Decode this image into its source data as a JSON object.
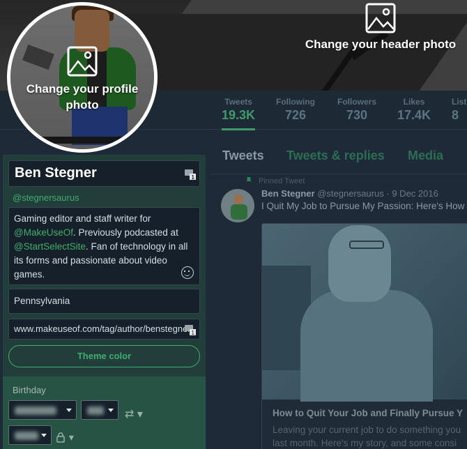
{
  "header": {
    "change_header_label": "Change your header photo"
  },
  "avatar": {
    "change_profile_label": "Change your profile photo"
  },
  "stats": [
    {
      "label": "Tweets",
      "value": "19.3K"
    },
    {
      "label": "Following",
      "value": "726"
    },
    {
      "label": "Followers",
      "value": "730"
    },
    {
      "label": "Likes",
      "value": "17.4K"
    },
    {
      "label": "Lists",
      "value": "8"
    }
  ],
  "profile_edit": {
    "name": "Ben Stegner",
    "handle": "@stegnersaurus",
    "bio": {
      "part1": "Gaming editor and staff writer for",
      "link1": "@MakeUseOf",
      "part2": ". Previously podcasted at",
      "link2": "@StartSelectSite",
      "part3": ". Fan of technology in all its forms and passionate about video games."
    },
    "location": "Pennsylvania",
    "website": "www.makeuseof.com/tag/author/benstegner",
    "theme_button": "Theme color",
    "birthday_label": "Birthday"
  },
  "timeline": {
    "tabs": [
      "Tweets",
      "Tweets & replies",
      "Media"
    ],
    "pinned_label": "Pinned Tweet",
    "tweet": {
      "author": "Ben Stegner",
      "meta": "@stegnersaurus · 9 Dec 2016",
      "text": "I Quit My Job to Pursue My Passion: Here's How",
      "card_title": "How to Quit Your Job and Finally Pursue Y",
      "card_desc_line1": "Leaving your current job to do something you",
      "card_desc_line2": "last month. Here's my story, and some consi"
    }
  },
  "colors": {
    "accent": "#3fae6c",
    "panel": "#213e3a",
    "background": "#1e2a37"
  }
}
